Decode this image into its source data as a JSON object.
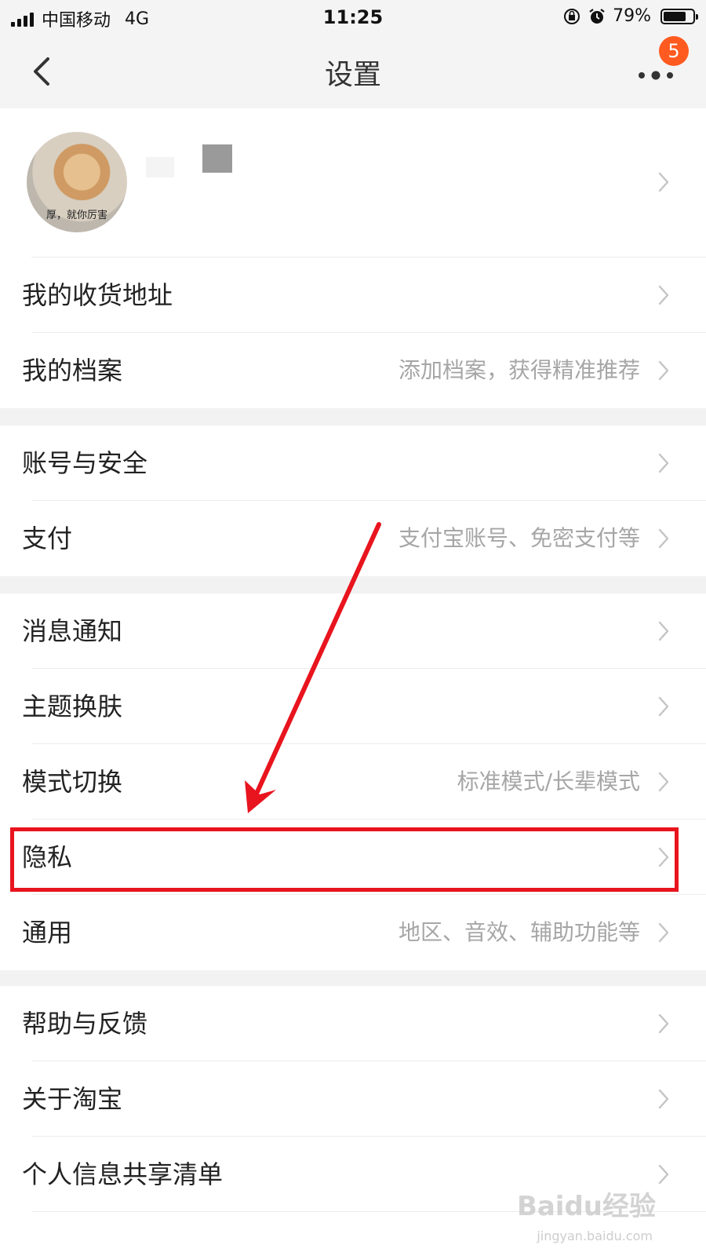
{
  "status_bar": {
    "carrier": "中国移动",
    "network": "4G",
    "time": "11:25",
    "battery": "79%",
    "battery_level": 0.79
  },
  "nav": {
    "title": "设置",
    "badge_count": "5"
  },
  "profile": {
    "avatar_caption": "厚，就你厉害"
  },
  "sections": {
    "s1": [
      {
        "label": "我的收货地址",
        "hint": ""
      },
      {
        "label": "我的档案",
        "hint": "添加档案，获得精准推荐"
      }
    ],
    "s2": [
      {
        "label": "账号与安全",
        "hint": ""
      },
      {
        "label": "支付",
        "hint": "支付宝账号、免密支付等"
      }
    ],
    "s3": [
      {
        "label": "消息通知",
        "hint": ""
      },
      {
        "label": "主题换肤",
        "hint": ""
      },
      {
        "label": "模式切换",
        "hint": "标准模式/长辈模式"
      },
      {
        "label": "隐私",
        "hint": ""
      },
      {
        "label": "通用",
        "hint": "地区、音效、辅助功能等"
      }
    ],
    "s4": [
      {
        "label": "帮助与反馈",
        "hint": ""
      },
      {
        "label": "关于淘宝",
        "hint": ""
      },
      {
        "label": "个人信息共享清单",
        "hint": ""
      }
    ]
  },
  "watermark": {
    "main": "Baidu经验",
    "sub": "jingyan.baidu.com"
  },
  "colors": {
    "accent": "#ff5a1f",
    "annotation": "#e8141e",
    "hint_text": "#a6a6a6"
  }
}
